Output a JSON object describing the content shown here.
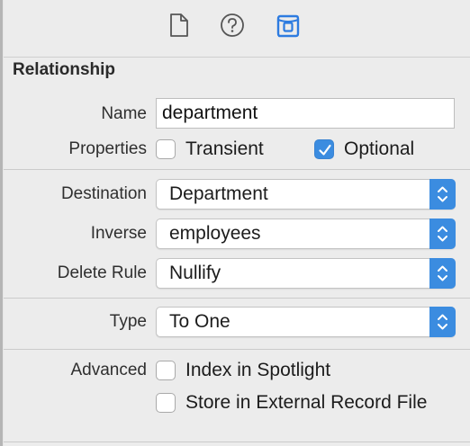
{
  "toolbar": {
    "icons": [
      "file-inspector-icon",
      "quick-help-icon",
      "data-model-inspector-icon"
    ],
    "active_color": "#2d7be0"
  },
  "section": {
    "title": "Relationship"
  },
  "name_field": {
    "label": "Name",
    "value": "department"
  },
  "properties": {
    "label": "Properties",
    "transient": {
      "label": "Transient",
      "checked": false
    },
    "optional": {
      "label": "Optional",
      "checked": true
    }
  },
  "destination": {
    "label": "Destination",
    "value": "Department"
  },
  "inverse": {
    "label": "Inverse",
    "value": "employees"
  },
  "delete_rule": {
    "label": "Delete Rule",
    "value": "Nullify"
  },
  "type": {
    "label": "Type",
    "value": "To One"
  },
  "advanced": {
    "label": "Advanced",
    "index_spotlight": {
      "label": "Index in Spotlight",
      "checked": false
    },
    "external_record": {
      "label": "Store in External Record File",
      "checked": false
    }
  },
  "colors": {
    "accent": "#3b8ce0",
    "background": "#ececec"
  }
}
